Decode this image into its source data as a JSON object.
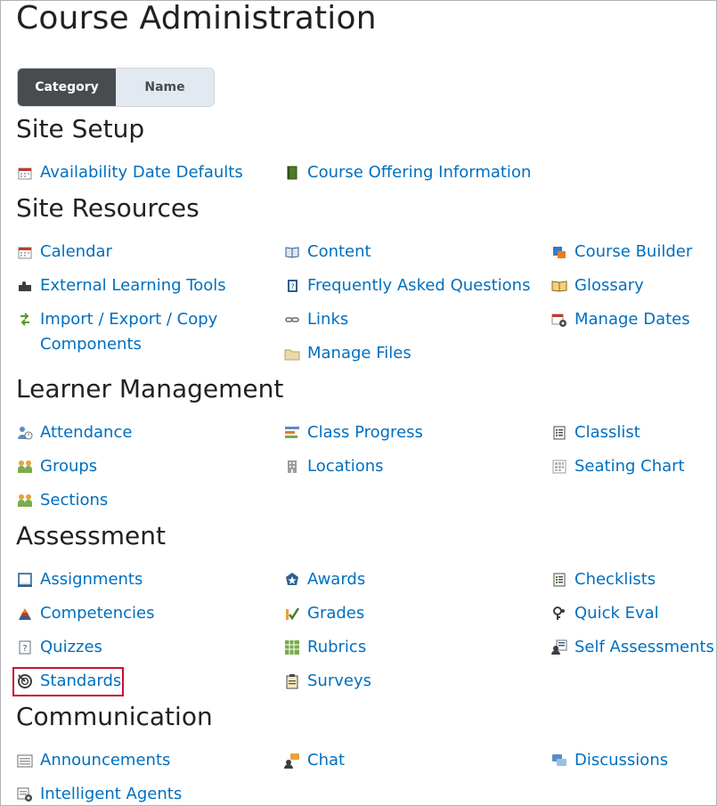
{
  "page": {
    "title": "Course Administration"
  },
  "view_toggle": {
    "category": "Category",
    "name": "Name"
  },
  "sections": {
    "site_setup": "Site Setup",
    "site_resources": "Site Resources",
    "learner_management": "Learner Management",
    "assessment": "Assessment",
    "communication": "Communication"
  },
  "items": {
    "availability_date_defaults": "Availability Date Defaults",
    "course_offering_information": "Course Offering Information",
    "calendar": "Calendar",
    "content": "Content",
    "course_builder": "Course Builder",
    "external_learning_tools": "External Learning Tools",
    "faq": "Frequently Asked Questions",
    "glossary": "Glossary",
    "import_export": "Import / Export / Copy Components",
    "links": "Links",
    "manage_dates": "Manage Dates",
    "manage_files": "Manage Files",
    "attendance": "Attendance",
    "class_progress": "Class Progress",
    "classlist": "Classlist",
    "groups": "Groups",
    "locations": "Locations",
    "seating_chart": "Seating Chart",
    "sections": "Sections",
    "assignments": "Assignments",
    "awards": "Awards",
    "checklists": "Checklists",
    "competencies": "Competencies",
    "grades": "Grades",
    "quick_eval": "Quick Eval",
    "quizzes": "Quizzes",
    "rubrics": "Rubrics",
    "self_assessments": "Self Assessments",
    "standards": "Standards",
    "surveys": "Surveys",
    "announcements": "Announcements",
    "chat": "Chat",
    "discussions": "Discussions",
    "intelligent_agents": "Intelligent Agents"
  },
  "colors": {
    "link": "#006fbf",
    "toggle_active": "#494c4e",
    "toggle_inactive": "#e3e9f1",
    "highlight": "#c8102e"
  }
}
